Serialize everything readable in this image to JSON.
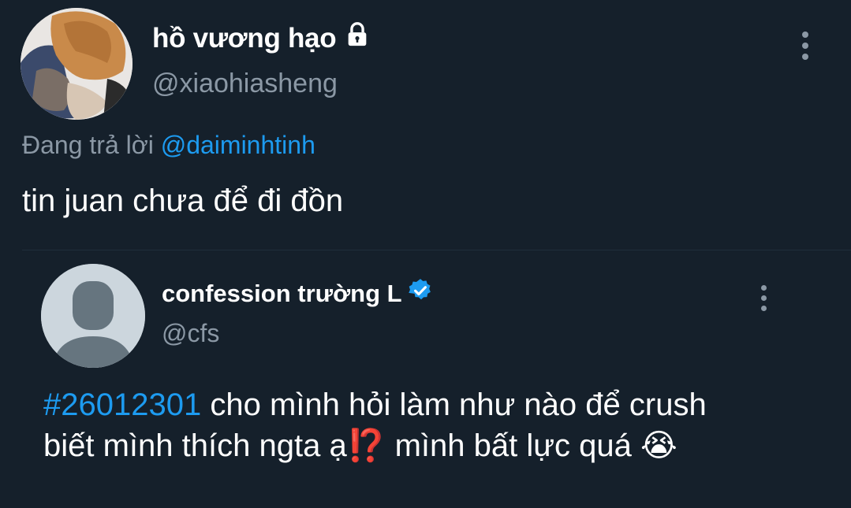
{
  "tweet": {
    "author": {
      "display_name": "hồ vương hạo",
      "handle": "@xiaohiasheng",
      "badge_icon": "lock-icon"
    },
    "reply_prefix": "Đang trả lời",
    "reply_to": "@daiminhtinh",
    "text": "tin juan chưa để đi đồn",
    "menu_icon": "more-vertical-icon"
  },
  "quoted_tweet": {
    "author": {
      "display_name": "confession trường L",
      "handle": "@cfs",
      "badge_icon": "verified-badge-icon"
    },
    "hashtag": "#26012301",
    "text_line1": " cho mình hỏi làm như nào để crush",
    "text_line2_a": "biết mình thích ngta ạ",
    "emoji_1": "⁉️",
    "text_line2_b": " mình bất lực quá ",
    "emoji_2": "😭",
    "menu_icon": "more-vertical-icon"
  },
  "colors": {
    "background": "#15202b",
    "accent": "#1d9bf0",
    "secondary_text": "#8b98a5",
    "verified": "#1d9bf0"
  }
}
